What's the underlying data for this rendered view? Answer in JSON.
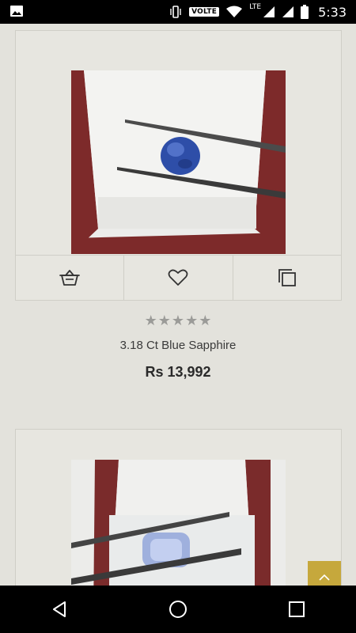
{
  "status_bar": {
    "time": "5:33",
    "volte": "VOLTE",
    "network": "LTE",
    "icons": [
      "gallery-icon",
      "vibrate-icon",
      "wifi-icon",
      "signal-icon",
      "signal-icon",
      "battery-icon"
    ]
  },
  "products": [
    {
      "name": "3.18 Ct Blue Sapphire",
      "price": "Rs 13,992",
      "rating": 0,
      "max_rating": 5,
      "actions": [
        "add-to-cart-icon",
        "wishlist-heart-icon",
        "compare-icon"
      ]
    },
    {
      "name": "",
      "price": ""
    }
  ],
  "scroll_top_icon": "chevron-up-icon",
  "nav_bar": {
    "icons": [
      "back-icon",
      "home-icon",
      "recents-icon"
    ]
  },
  "colors": {
    "background": "#e3e2dc",
    "accent": "#c6a83c",
    "star": "#9b9b98"
  }
}
